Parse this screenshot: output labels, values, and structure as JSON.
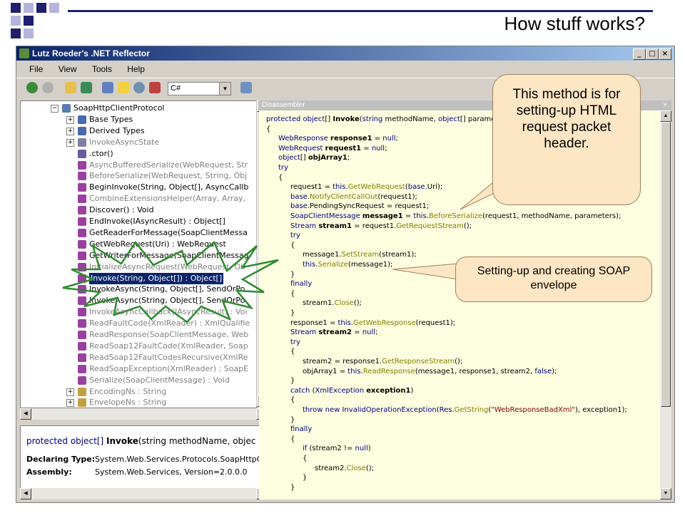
{
  "slide": {
    "title": "How stuff works?",
    "callout_method": "This method is for setting-up HTML request packet header.",
    "callout_soap": "Setting-up and creating SOAP envelope"
  },
  "window": {
    "title": "Lutz Roeder's .NET Reflector",
    "minimize": "_",
    "maximize": "□",
    "close": "×"
  },
  "menu": [
    "File",
    "View",
    "Tools",
    "Help"
  ],
  "toolbar": {
    "language": "C#"
  },
  "tree": [
    {
      "label": "SoapHttpClientProtocol",
      "expander": "⊟",
      "indent": 0,
      "style": "normal",
      "icon": "class-icon"
    },
    {
      "label": "Base Types",
      "expander": "⊞",
      "indent": 1,
      "style": "normal",
      "icon": "base-types-icon"
    },
    {
      "label": "Derived Types",
      "expander": "⊞",
      "indent": 1,
      "style": "normal",
      "icon": "derived-types-icon"
    },
    {
      "label": "InvokeAsyncState",
      "expander": "⊞",
      "indent": 1,
      "style": "gray",
      "icon": "nested-class-icon"
    },
    {
      "label": ".ctor()",
      "expander": "",
      "indent": 1,
      "style": "normal",
      "icon": "constructor-icon"
    },
    {
      "label": "AsyncBufferedSerialize(WebRequest, Str",
      "expander": "",
      "indent": 1,
      "style": "gray",
      "icon": "method-icon"
    },
    {
      "label": "BeforeSerialize(WebRequest, String, Obj",
      "expander": "",
      "indent": 1,
      "style": "gray",
      "icon": "method-icon"
    },
    {
      "label": "BeginInvoke(String, Object[], AsyncCallb",
      "expander": "",
      "indent": 1,
      "style": "normal",
      "icon": "method-icon"
    },
    {
      "label": "CombineExtensionsHelper(Array, Array,",
      "expander": "",
      "indent": 1,
      "style": "gray",
      "icon": "method-icon"
    },
    {
      "label": "Discover() : Void",
      "expander": "",
      "indent": 1,
      "style": "normal",
      "icon": "method-icon"
    },
    {
      "label": "EndInvoke(IAsyncResult) : Object[]",
      "expander": "",
      "indent": 1,
      "style": "normal",
      "icon": "method-icon"
    },
    {
      "label": "GetReaderForMessage(SoapClientMessa",
      "expander": "",
      "indent": 1,
      "style": "normal",
      "icon": "method-icon"
    },
    {
      "label": "GetWebRequest(Uri) : WebRequest",
      "expander": "",
      "indent": 1,
      "style": "normal",
      "icon": "method-icon"
    },
    {
      "label": "GetWriterForMessage(SoapClientMessag",
      "expander": "",
      "indent": 1,
      "style": "normal",
      "icon": "method-icon"
    },
    {
      "label": "InitializeAsyncRequest(WebRequest, Ob",
      "expander": "",
      "indent": 1,
      "style": "gray",
      "icon": "method-icon"
    },
    {
      "label": "Invoke(String, Object[]) : Object[]",
      "expander": "",
      "indent": 1,
      "style": "sel",
      "icon": "method-icon"
    },
    {
      "label": "InvokeAsync(String, Object[], SendOrPo",
      "expander": "",
      "indent": 1,
      "style": "normal",
      "icon": "method-icon"
    },
    {
      "label": "InvokeAsync(String, Object[], SendOrPo",
      "expander": "",
      "indent": 1,
      "style": "normal",
      "icon": "method-icon"
    },
    {
      "label": "InvokeAsyncCallback(IAsyncResult) : Voi",
      "expander": "",
      "indent": 1,
      "style": "gray",
      "icon": "method-icon"
    },
    {
      "label": "ReadFaultCode(XmlReader) : XmlQualifie",
      "expander": "",
      "indent": 1,
      "style": "gray",
      "icon": "method-icon"
    },
    {
      "label": "ReadResponse(SoapClientMessage, Web",
      "expander": "",
      "indent": 1,
      "style": "gray",
      "icon": "method-icon"
    },
    {
      "label": "ReadSoap12FaultCode(XmlReader, Soap",
      "expander": "",
      "indent": 1,
      "style": "gray",
      "icon": "method-icon"
    },
    {
      "label": "ReadSoap12FaultCodesRecursive(XmlRe",
      "expander": "",
      "indent": 1,
      "style": "gray",
      "icon": "method-icon"
    },
    {
      "label": "ReadSoapException(XmlReader) : SoapE",
      "expander": "",
      "indent": 1,
      "style": "gray",
      "icon": "method-icon"
    },
    {
      "label": "Serialize(SoapClientMessage) : Void",
      "expander": "",
      "indent": 1,
      "style": "gray",
      "icon": "method-icon"
    },
    {
      "label": "EncodingNs : String",
      "expander": "⊞",
      "indent": 1,
      "style": "gray",
      "icon": "property-icon"
    },
    {
      "label": "EnvelopeNs : String",
      "expander": "⊞",
      "indent": 1,
      "style": "gray",
      "icon": "property-icon"
    }
  ],
  "info": {
    "signature_prefix": "protected object[] ",
    "signature_method": "Invoke",
    "signature_suffix": "(string methodName, objec",
    "declaring_type_label": "Declaring Type:",
    "declaring_type_value": "System.Web.Services.Protocols.SoapHttpCl",
    "assembly_label": "Assembly:",
    "assembly_value": "System.Web.Services, Version=2.0.0.0"
  },
  "disassembler": {
    "title": "Disassembler",
    "close": "×",
    "lines": [
      {
        "indent": 0,
        "parts": [
          [
            "kw",
            "protected "
          ],
          [
            "kw",
            "object"
          ],
          [
            "",
            "[] "
          ],
          [
            "b",
            "Invoke"
          ],
          [
            "",
            "("
          ],
          [
            "kw",
            "string "
          ],
          [
            "",
            "methodName, "
          ],
          [
            "kw",
            "object"
          ],
          [
            "",
            "[] parameters)"
          ]
        ]
      },
      {
        "indent": 0,
        "parts": [
          [
            "",
            "{"
          ]
        ]
      },
      {
        "indent": 1,
        "parts": [
          [
            "kw",
            "WebResponse "
          ],
          [
            "b",
            "response1"
          ],
          [
            "",
            " = "
          ],
          [
            "kw",
            "null"
          ],
          [
            "",
            ";"
          ]
        ]
      },
      {
        "indent": 1,
        "parts": [
          [
            "kw",
            "WebRequest "
          ],
          [
            "b",
            "request1"
          ],
          [
            "",
            " = "
          ],
          [
            "kw",
            "null"
          ],
          [
            "",
            ";"
          ]
        ]
      },
      {
        "indent": 1,
        "parts": [
          [
            "kw",
            "object"
          ],
          [
            "",
            "[] "
          ],
          [
            "b",
            "objArray1"
          ],
          [
            "",
            ";"
          ]
        ]
      },
      {
        "indent": 1,
        "parts": [
          [
            "kw",
            "try"
          ]
        ]
      },
      {
        "indent": 1,
        "parts": [
          [
            "",
            "{"
          ]
        ]
      },
      {
        "indent": 2,
        "parts": [
          [
            "",
            "request1 = "
          ],
          [
            "kw",
            "this"
          ],
          [
            "",
            "."
          ],
          [
            "mt",
            "GetWebRequest"
          ],
          [
            "",
            "("
          ],
          [
            "kw",
            "base"
          ],
          [
            "",
            ".Uri);"
          ]
        ]
      },
      {
        "indent": 2,
        "parts": [
          [
            "kw",
            "base"
          ],
          [
            "",
            "."
          ],
          [
            "mt",
            "NotifyClientCallOut"
          ],
          [
            "",
            "(request1);"
          ]
        ]
      },
      {
        "indent": 2,
        "parts": [
          [
            "kw",
            "base"
          ],
          [
            "",
            ".PendingSyncRequest = request1;"
          ]
        ]
      },
      {
        "indent": 2,
        "parts": [
          [
            "kw",
            "SoapClientMessage "
          ],
          [
            "b",
            "message1"
          ],
          [
            "",
            " = "
          ],
          [
            "kw",
            "this"
          ],
          [
            "",
            "."
          ],
          [
            "mt",
            "BeforeSerialize"
          ],
          [
            "",
            "(request1, methodName, parameters);"
          ]
        ]
      },
      {
        "indent": 2,
        "parts": [
          [
            "kw",
            "Stream "
          ],
          [
            "b",
            "stream1"
          ],
          [
            "",
            " = request1."
          ],
          [
            "mt",
            "GetRequestStream"
          ],
          [
            "",
            "();"
          ]
        ]
      },
      {
        "indent": 2,
        "parts": [
          [
            "kw",
            "try"
          ]
        ]
      },
      {
        "indent": 2,
        "parts": [
          [
            "",
            "{"
          ]
        ]
      },
      {
        "indent": 3,
        "parts": [
          [
            "",
            "message1."
          ],
          [
            "mt",
            "SetStream"
          ],
          [
            "",
            "(stream1);"
          ]
        ]
      },
      {
        "indent": 3,
        "parts": [
          [
            "kw",
            "this"
          ],
          [
            "",
            "."
          ],
          [
            "mt",
            "Serialize"
          ],
          [
            "",
            "(message1);"
          ]
        ]
      },
      {
        "indent": 2,
        "parts": [
          [
            "",
            "}"
          ]
        ]
      },
      {
        "indent": 2,
        "parts": [
          [
            "kw",
            "finally"
          ]
        ]
      },
      {
        "indent": 2,
        "parts": [
          [
            "",
            "{"
          ]
        ]
      },
      {
        "indent": 3,
        "parts": [
          [
            "",
            "stream1."
          ],
          [
            "mt",
            "Close"
          ],
          [
            "",
            "();"
          ]
        ]
      },
      {
        "indent": 2,
        "parts": [
          [
            "",
            "}"
          ]
        ]
      },
      {
        "indent": 2,
        "parts": [
          [
            "",
            "response1 = "
          ],
          [
            "kw",
            "this"
          ],
          [
            "",
            "."
          ],
          [
            "mt",
            "GetWebResponse"
          ],
          [
            "",
            "(request1);"
          ]
        ]
      },
      {
        "indent": 2,
        "parts": [
          [
            "kw",
            "Stream "
          ],
          [
            "b",
            "stream2"
          ],
          [
            "",
            " = "
          ],
          [
            "kw",
            "null"
          ],
          [
            "",
            ";"
          ]
        ]
      },
      {
        "indent": 2,
        "parts": [
          [
            "kw",
            "try"
          ]
        ]
      },
      {
        "indent": 2,
        "parts": [
          [
            "",
            "{"
          ]
        ]
      },
      {
        "indent": 3,
        "parts": [
          [
            "",
            "stream2 = response1."
          ],
          [
            "mt",
            "GetResponseStream"
          ],
          [
            "",
            "();"
          ]
        ]
      },
      {
        "indent": 3,
        "parts": [
          [
            "",
            "objArray1 = "
          ],
          [
            "kw",
            "this"
          ],
          [
            "",
            "."
          ],
          [
            "mt",
            "ReadResponse"
          ],
          [
            "",
            "(message1, response1, stream2, "
          ],
          [
            "kw",
            "false"
          ],
          [
            "",
            ");"
          ]
        ]
      },
      {
        "indent": 2,
        "parts": [
          [
            "",
            "}"
          ]
        ]
      },
      {
        "indent": 2,
        "parts": [
          [
            "kw",
            "catch "
          ],
          [
            "",
            "("
          ],
          [
            "kw",
            "XmlException "
          ],
          [
            "b",
            "exception1"
          ],
          [
            "",
            ")"
          ]
        ]
      },
      {
        "indent": 2,
        "parts": [
          [
            "",
            "{"
          ]
        ]
      },
      {
        "indent": 3,
        "parts": [
          [
            "kw",
            "throw new "
          ],
          [
            "kw",
            "InvalidOperationException"
          ],
          [
            "",
            "("
          ],
          [
            "kw",
            "Res"
          ],
          [
            "",
            "."
          ],
          [
            "mt",
            "GetString"
          ],
          [
            "",
            "("
          ],
          [
            "st",
            "\"WebResponseBadXml\""
          ],
          [
            "",
            "), exception1);"
          ]
        ]
      },
      {
        "indent": 2,
        "parts": [
          [
            "",
            "}"
          ]
        ]
      },
      {
        "indent": 2,
        "parts": [
          [
            "kw",
            "finally"
          ]
        ]
      },
      {
        "indent": 2,
        "parts": [
          [
            "",
            "{"
          ]
        ]
      },
      {
        "indent": 3,
        "parts": [
          [
            "kw",
            "if "
          ],
          [
            "",
            "(stream2 != "
          ],
          [
            "kw",
            "null"
          ],
          [
            "",
            ")"
          ]
        ]
      },
      {
        "indent": 3,
        "parts": [
          [
            "",
            "{"
          ]
        ]
      },
      {
        "indent": 4,
        "parts": [
          [
            "",
            "stream2."
          ],
          [
            "mt",
            "Close"
          ],
          [
            "",
            "();"
          ]
        ]
      },
      {
        "indent": 3,
        "parts": [
          [
            "",
            "}"
          ]
        ]
      },
      {
        "indent": 2,
        "parts": [
          [
            "",
            "}"
          ]
        ]
      }
    ]
  },
  "colors": {
    "deco_dark": "#1f1f6e",
    "deco_light": "#b4b4dc",
    "callout_fill": "#fde6c4",
    "starburst": "#2e8b2e",
    "keyword": "#000080",
    "method": "#7f7f00"
  }
}
